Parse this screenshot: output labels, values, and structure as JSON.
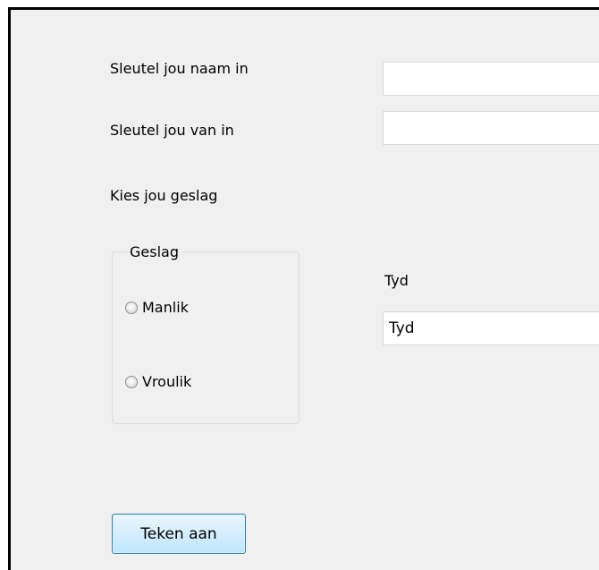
{
  "form": {
    "name_label": "Sleutel jou naam in",
    "name_value": "",
    "surname_label": "Sleutel jou van in",
    "surname_value": "",
    "gender_prompt": "Kies jou geslag",
    "gender_group": {
      "legend": "Geslag",
      "options": [
        {
          "label": "Manlik",
          "checked": false
        },
        {
          "label": "Vroulik",
          "checked": false
        }
      ]
    },
    "time_label": "Tyd",
    "time_value": "Tyd",
    "submit_label": "Teken aan"
  }
}
